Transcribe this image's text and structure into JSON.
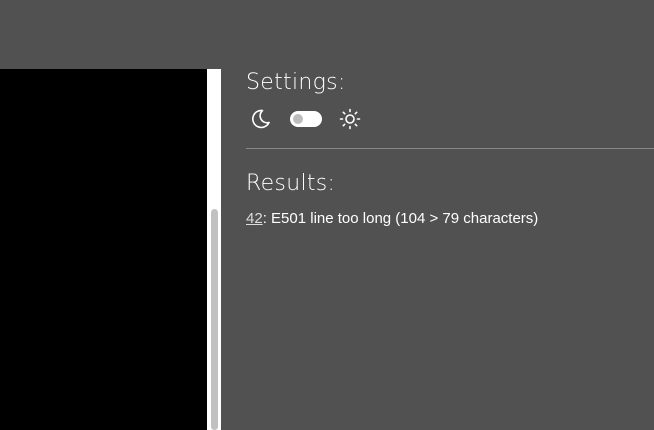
{
  "settings": {
    "heading": "Settings:",
    "theme_icons": {
      "dark": "moon-icon",
      "light": "sun-icon"
    },
    "theme_toggle": {
      "state": "off"
    }
  },
  "results": {
    "heading": "Results:",
    "items": [
      {
        "line": "42",
        "separator": ": ",
        "message": "E501 line too long (104 > 79 characters)"
      }
    ]
  },
  "colors": {
    "background": "#515151",
    "editor_background": "#000000",
    "text": "#ffffff",
    "divider": "#888888"
  }
}
